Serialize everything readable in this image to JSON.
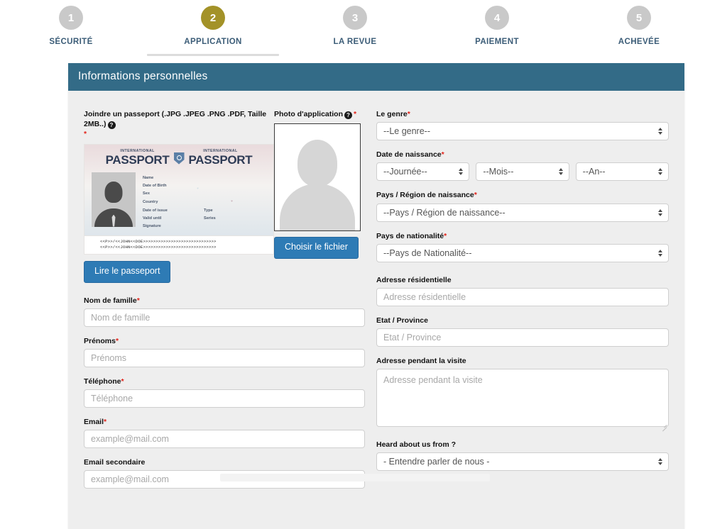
{
  "stepper": {
    "steps": [
      {
        "number": "1",
        "label": "SÉCURITÉ",
        "active": false
      },
      {
        "number": "2",
        "label": "APPLICATION",
        "active": true
      },
      {
        "number": "3",
        "label": "LA REVUE",
        "active": false
      },
      {
        "number": "4",
        "label": "PAIEMENT",
        "active": false
      },
      {
        "number": "5",
        "label": "ACHEVÉE",
        "active": false
      }
    ],
    "active_index": 1
  },
  "panel": {
    "title": "Informations personnelles",
    "header_color": "#336b87",
    "accent_color": "#a39228",
    "required_color": "#e2231a",
    "button_color": "#2e7bb5"
  },
  "upload": {
    "passport_label": "Joindre un passeport (.JPG .JPEG .PNG .PDF, Taille 2MB..)",
    "passport_help_icon": "question-mark-circle-icon",
    "passport_required": "*",
    "passport_button": "Lire le passeport",
    "photo_label": "Photo d'application",
    "photo_help_icon": "question-mark-circle-icon",
    "photo_required": "*",
    "photo_button": "Choisir le fichier"
  },
  "passport_specimen": {
    "sub_left": "INTERNATIONAL",
    "title_left": "PASSPORT",
    "sub_right": "INTERNATIONAL",
    "title_right": "PASSPORT",
    "fields_primary": [
      "Name",
      "Date of Birth",
      "Sex",
      "Country"
    ],
    "fields_secondary": [
      "Date of issue",
      "Valid until",
      "Signature"
    ],
    "fields_tertiary": [
      "Type",
      "Series"
    ],
    "mrz_line1": "<<P>>/<<JOHN<<DOE>>>>>>>>>>>>>>>>>>>>>>>>>>>>>",
    "mrz_line2": "<<P>>/<<JOHN<<DOE>>>>>>>>>>>>>>>>>>>>>>>>>>>>>"
  },
  "form": {
    "left": {
      "nom_label": "Nom de famille",
      "nom_required": "*",
      "nom_placeholder": "Nom de famille",
      "nom_value": "",
      "prenoms_label": "Prénoms",
      "prenoms_required": "*",
      "prenoms_placeholder": "Prénoms",
      "prenoms_value": "",
      "telephone_label": "Téléphone",
      "telephone_required": "*",
      "telephone_placeholder": "Téléphone",
      "telephone_value": "",
      "email_label": "Email",
      "email_required": "*",
      "email_placeholder": "example@mail.com",
      "email_value": "",
      "email2_label": "Email secondaire",
      "email2_placeholder": "example@mail.com",
      "email2_value": ""
    },
    "right": {
      "genre_label": "Le genre",
      "genre_required": "*",
      "genre_value": "--Le genre--",
      "dob_label": "Date de naissance",
      "dob_required": "*",
      "dob_day_value": "--Journée--",
      "dob_month_value": "--Mois--",
      "dob_year_value": "--An--",
      "pays_naissance_label": "Pays / Région de naissance",
      "pays_naissance_required": "*",
      "pays_naissance_value": "--Pays / Région de naissance--",
      "nationalite_label": "Pays de nationalité",
      "nationalite_required": "*",
      "nationalite_value": "--Pays de Nationalité--",
      "adresse_label": "Adresse résidentielle",
      "adresse_placeholder": "Adresse résidentielle",
      "adresse_value": "",
      "etat_label": "Etat / Province",
      "etat_placeholder": "Etat / Province",
      "etat_value": "",
      "visite_label": "Adresse pendant la visite",
      "visite_placeholder": "Adresse pendant la visite",
      "visite_value": "",
      "heard_label": "Heard about us from ?",
      "heard_value": "- Entendre parler de nous -"
    }
  }
}
